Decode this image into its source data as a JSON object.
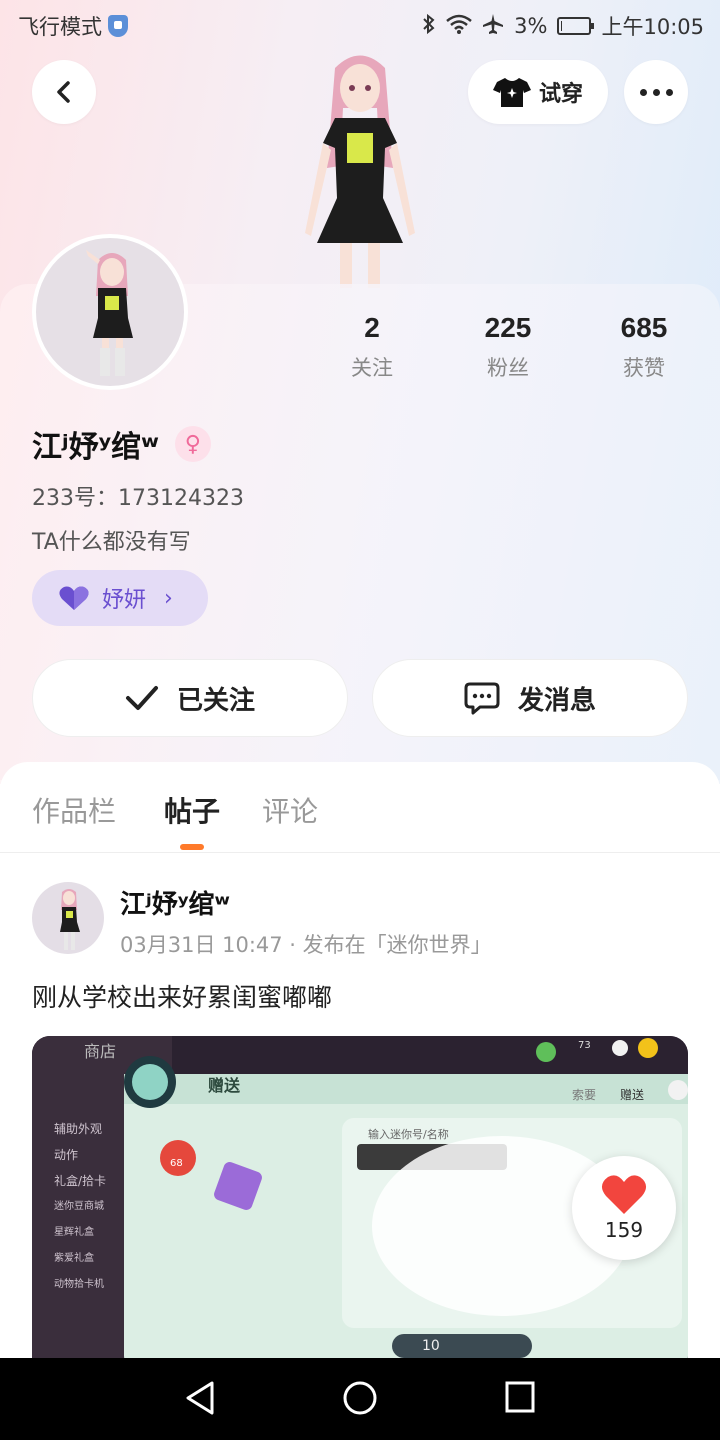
{
  "status_bar": {
    "mode": "飞行模式",
    "battery": "3%",
    "battery_level": 0.03,
    "time": "上午10:05"
  },
  "header": {
    "try_on_label": "试穿"
  },
  "profile": {
    "stats": [
      {
        "value": "2",
        "label": "关注"
      },
      {
        "value": "225",
        "label": "粉丝"
      },
      {
        "value": "685",
        "label": "获赞"
      }
    ],
    "name": "江ʲ妤ʸ绾ʷ",
    "uid": "233号：173124323",
    "bio": "TA什么都没有写",
    "tag_label": "妤妍",
    "follow_label": "已关注",
    "message_label": "发消息"
  },
  "tabs": [
    {
      "label": "作品栏",
      "active": false
    },
    {
      "label": "帖子",
      "active": true
    },
    {
      "label": "评论",
      "active": false
    }
  ],
  "post": {
    "author": "江ʲ妤ʸ绾ʷ",
    "meta": "03月31日 10:47 · 发布在「迷你世界」",
    "text": "刚从学校出来好累闺蜜嘟嘟",
    "likes": "159"
  },
  "post_image": {
    "shop_label": "商店",
    "gift_title": "赠送",
    "gift_label": "赠送",
    "ask_label": "索要",
    "input_placeholder": "输入迷你号/名称",
    "quantity": "10",
    "gift_tag": "68",
    "coins": "73",
    "side_menu": [
      "辅助外观",
      "动作",
      "礼盒/拾卡",
      "迷你豆商城",
      "星辉礼盒",
      "紫爱礼盒",
      "动物拾卡机"
    ]
  },
  "colors": {
    "accent": "#ff7a2a",
    "tag_bg": "#e4dcf6",
    "tag_fg": "#6a4fd0",
    "heart": "#f2453e"
  }
}
